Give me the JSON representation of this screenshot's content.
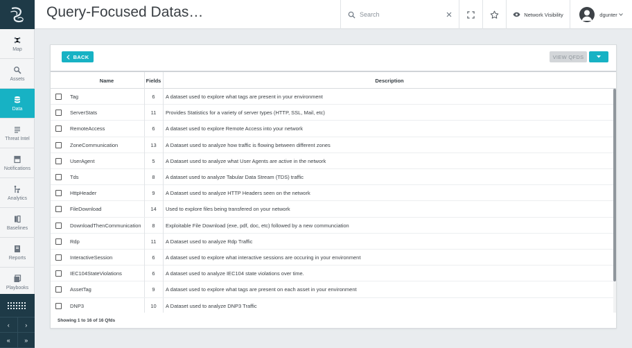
{
  "header": {
    "title": "Query-Focused Datas…",
    "search_placeholder": "Search",
    "network_visibility": "Network Visibility",
    "user": "dgunter"
  },
  "sidebar": {
    "items": [
      {
        "label": "Map",
        "icon": "map-icon"
      },
      {
        "label": "Assets",
        "icon": "assets-icon"
      },
      {
        "label": "Data",
        "icon": "database-icon"
      },
      {
        "label": "Threat Intel",
        "icon": "threat-intel-icon"
      },
      {
        "label": "Notifications",
        "icon": "notifications-icon"
      },
      {
        "label": "Analytics",
        "icon": "analytics-icon"
      },
      {
        "label": "Baselines",
        "icon": "baselines-icon"
      },
      {
        "label": "Reports",
        "icon": "reports-icon"
      },
      {
        "label": "Playbooks",
        "icon": "playbooks-icon"
      }
    ],
    "pager": [
      "‹",
      "›",
      "«",
      "»"
    ]
  },
  "toolbar": {
    "back_label": "BACK",
    "view_label": "VIEW QFDS"
  },
  "table": {
    "columns": [
      "Name",
      "Fields",
      "Description"
    ],
    "rows": [
      {
        "name": "Tag",
        "fields": "6",
        "description": "A dataset used to explore what tags are present in your environment"
      },
      {
        "name": "ServerStats",
        "fields": "11",
        "description": "Provides Statistics for a variety of server types (HTTP, SSL, Mail, etc)"
      },
      {
        "name": "RemoteAccess",
        "fields": "6",
        "description": "A dataset used to explore Remote Access into your network"
      },
      {
        "name": "ZoneCommunication",
        "fields": "13",
        "description": "A Dataset used to analyze how traffic is flowing between different zones"
      },
      {
        "name": "UserAgent",
        "fields": "5",
        "description": "A Dataset used to analyze what User Agents are active in the network"
      },
      {
        "name": "Tds",
        "fields": "8",
        "description": "A dataset used to analyze Tabular Data Stream (TDS) traffic"
      },
      {
        "name": "HttpHeader",
        "fields": "9",
        "description": "A Dataset used to analyze HTTP Headers seen on the network"
      },
      {
        "name": "FileDownload",
        "fields": "14",
        "description": "Used to explore files being transfered on your network"
      },
      {
        "name": "DownloadThenCommunication",
        "fields": "8",
        "description": "Exploitable File Download (exe, pdf, doc, etc) followed by a new communciation"
      },
      {
        "name": "Rdp",
        "fields": "11",
        "description": "A Dataset used to analyze Rdp Traffic"
      },
      {
        "name": "InteractiveSession",
        "fields": "6",
        "description": "A dataset used to explore what interactive sessions are occuring in your environment"
      },
      {
        "name": "IEC104StateViolations",
        "fields": "6",
        "description": "A dataset used to analyze IEC104 state violations over time."
      },
      {
        "name": "AssetTag",
        "fields": "9",
        "description": "A dataset used to explore what tags are present on each asset in your environment"
      },
      {
        "name": "DNP3",
        "fields": "10",
        "description": "A Dataset used to analyze DNP3 Traffic"
      }
    ],
    "footer": "Showing 1 to 16 of 16 Qfds"
  },
  "colors": {
    "accent": "#17b2c4",
    "sidebar_dark": "#1e3a47"
  }
}
